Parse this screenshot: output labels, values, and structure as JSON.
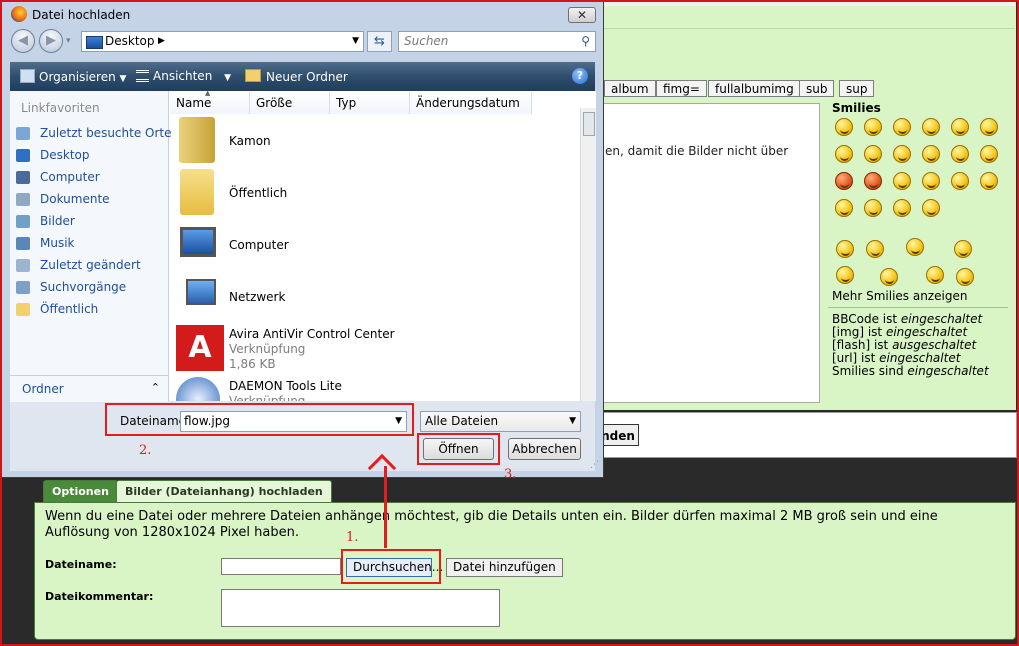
{
  "dialog": {
    "title": "Datei hochladen",
    "address": "Desktop",
    "search_placeholder": "Suchen",
    "toolbar": {
      "organize": "Organisieren",
      "views": "Ansichten",
      "new_folder": "Neuer Ordner"
    },
    "nav": {
      "header": "Linkfavoriten",
      "items": [
        "Zuletzt besuchte Orte",
        "Desktop",
        "Computer",
        "Dokumente",
        "Bilder",
        "Musik",
        "Zuletzt geändert",
        "Suchvorgänge",
        "Öffentlich"
      ],
      "folder_label": "Ordner"
    },
    "columns": [
      "Name",
      "Größe",
      "Typ",
      "Änderungsdatum"
    ],
    "files": [
      {
        "name": "Kamon"
      },
      {
        "name": "Öffentlich"
      },
      {
        "name": "Computer"
      },
      {
        "name": "Netzwerk"
      },
      {
        "name": "Avira AntiVir Control Center",
        "type": "Verknüpfung",
        "size": "1,86 KB"
      },
      {
        "name": "DAEMON Tools Lite",
        "type": "Verknüpfung"
      }
    ],
    "filename_label": "Dateiname:",
    "filename_value": "flow.jpg",
    "filetype": "Alle Dateien",
    "open": "Öffnen",
    "cancel": "Abbrechen"
  },
  "forum": {
    "bbcode_buttons": [
      "album",
      "fimg=",
      "fullalbumimg",
      "sub",
      "sup"
    ],
    "editor_text": "en, damit die Bilder nicht über",
    "smilies_title": "Smilies",
    "more_smilies": "Mehr Smilies anzeigen",
    "status": [
      {
        "prefix": "BBCode ist ",
        "value": "eingeschaltet"
      },
      {
        "prefix": "[img] ist ",
        "value": "eingeschaltet"
      },
      {
        "prefix": "[flash] ist ",
        "value": "ausgeschaltet"
      },
      {
        "prefix": "[url] ist ",
        "value": "eingeschaltet"
      },
      {
        "prefix": "Smilies sind ",
        "value": "eingeschaltet"
      }
    ],
    "submit_partial": "nden",
    "tabs": [
      "Optionen",
      "Bilder (Dateianhang) hochladen"
    ],
    "description": "Wenn du eine Datei oder mehrere Dateien anhängen möchtest, gib die Details unten ein. Bilder dürfen maximal 2 MB groß sein und eine Auflösung von 1280x1024 Pixel haben.",
    "filename_label": "Dateiname:",
    "browse": "Durchsuchen...",
    "add_file": "Datei hinzufügen",
    "comment_label": "Dateikommentar:"
  },
  "annotations": {
    "step1": "1.",
    "step2": "2.",
    "step3": "3."
  },
  "colors": {
    "annotation_red": "#e41c1c",
    "panel_green": "#d9f5c5",
    "tab_green": "#4a8a3a"
  }
}
